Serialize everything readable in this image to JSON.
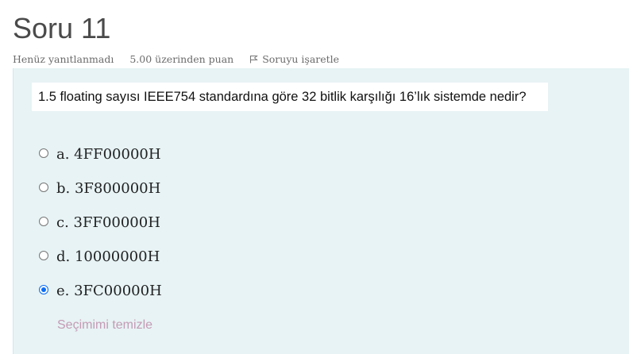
{
  "question": {
    "title": "Soru 11",
    "status": "Henüz yanıtlanmadı",
    "points": "5.00 üzerinden puan",
    "flag_label": "Soruyu işaretle",
    "text": "1.5 floating sayısı IEEE754 standardına göre 32 bitlik karşılığı 16’lık sistemde nedir?",
    "answers": [
      {
        "label": "a. 4FF00000H",
        "selected": false
      },
      {
        "label": "b. 3F800000H",
        "selected": false
      },
      {
        "label": "c. 3FF00000H",
        "selected": false
      },
      {
        "label": "d. 10000000H",
        "selected": false
      },
      {
        "label": "e. 3FC00000H",
        "selected": true
      }
    ],
    "clear_label": "Seçimimi temizle"
  },
  "icons": {
    "flag": "flag-icon",
    "radio": "radio-button"
  },
  "colors": {
    "panel_bg": "#e7f3f5",
    "accent": "#0a6cf5",
    "clear_link": "#c49bb4",
    "title": "#4a4a4a"
  }
}
